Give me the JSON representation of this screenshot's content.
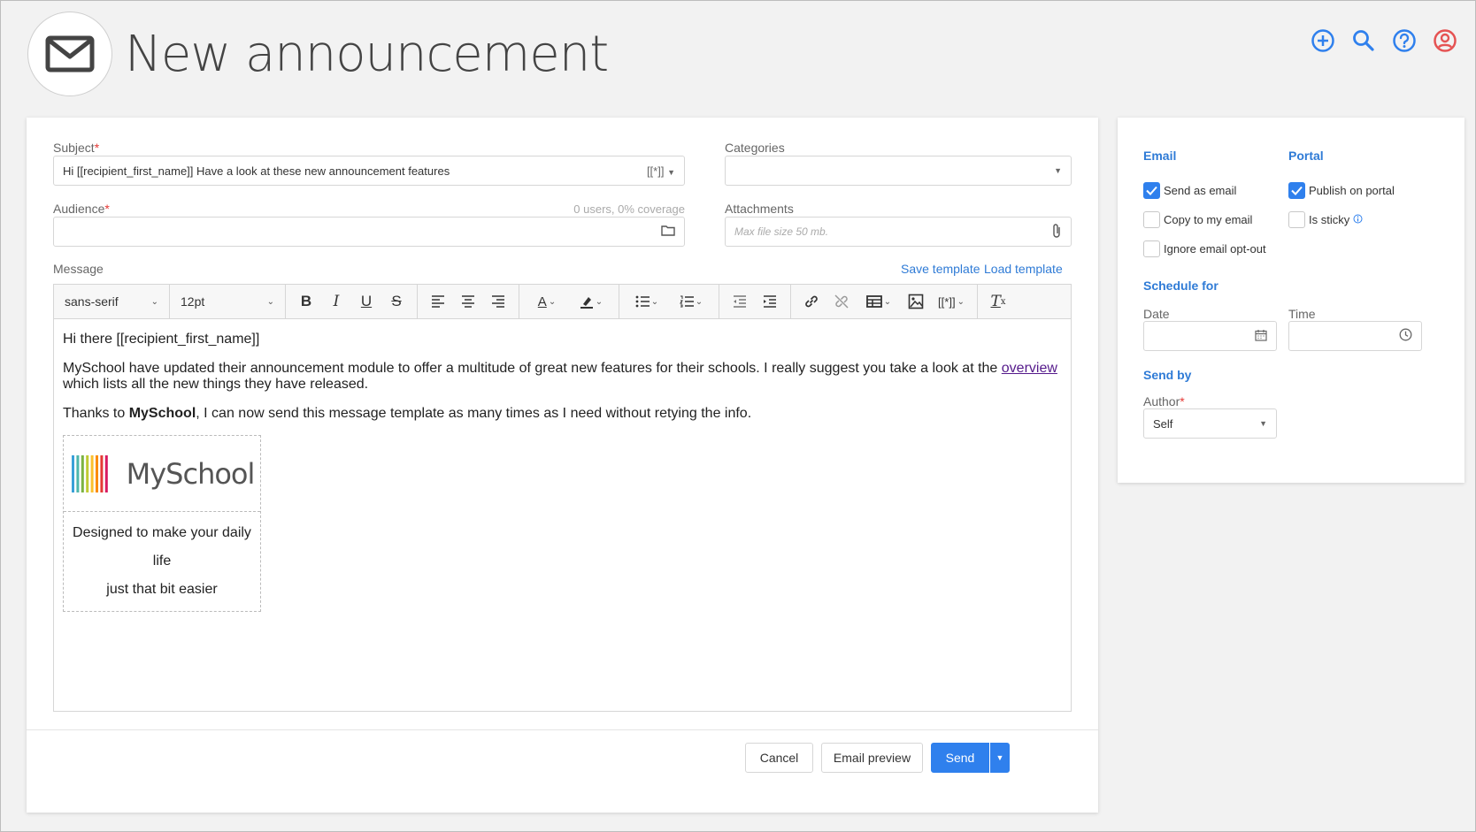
{
  "header": {
    "title": "New announcement"
  },
  "form": {
    "subject": {
      "label": "Subject",
      "required_mark": "*",
      "value": "Hi [[recipient_first_name]] Have a look at these new announcement features",
      "merge_tag": "[[*]]"
    },
    "categories": {
      "label": "Categories",
      "value": ""
    },
    "audience": {
      "label": "Audience",
      "required_mark": "*",
      "coverage": "0 users, 0% coverage",
      "value": ""
    },
    "attachments": {
      "label": "Attachments",
      "placeholder": "Max file size 50 mb."
    },
    "message": {
      "label": "Message",
      "save_template": "Save template",
      "load_template": "Load template"
    }
  },
  "toolbar": {
    "font_family": "sans-serif",
    "font_size": "12pt",
    "merge_tag": "[[*]]"
  },
  "editor": {
    "greeting": "Hi there [[recipient_first_name]]",
    "para1_start": "MySchool have updated their announcement module to offer a multitude of great new features for their schools. I really suggest you take a look at the ",
    "para1_link": "overview",
    "para1_end": " which lists all the new things they have released.",
    "para2_start": "Thanks to ",
    "para2_bold": "MySchool",
    "para2_end": ", I can now send this message template as many times as I need without retying the info.",
    "logo_text": "MySchool",
    "tagline_line1": "Designed to make your daily life",
    "tagline_line2": "just that bit easier",
    "logo_colors": [
      "#3aa0d8",
      "#4db6ac",
      "#7cb342",
      "#c0ca33",
      "#fbc02d",
      "#fb8c00",
      "#e53935",
      "#d81b60"
    ]
  },
  "footer": {
    "cancel": "Cancel",
    "email_preview": "Email preview",
    "send": "Send"
  },
  "side": {
    "email_title": "Email",
    "portal_title": "Portal",
    "send_as_email": "Send as email",
    "copy_to_my_email": "Copy to my email",
    "ignore_opt_out": "Ignore email opt-out",
    "publish_on_portal": "Publish on portal",
    "is_sticky": "Is sticky",
    "schedule_title": "Schedule for",
    "date_label": "Date",
    "time_label": "Time",
    "send_by_title": "Send by",
    "author_label": "Author",
    "author_required": "*",
    "author_value": "Self"
  },
  "colors": {
    "accent": "#2f80ed",
    "link": "#2f7bd6",
    "required": "#e53935",
    "profile_icon": "#e55353"
  }
}
